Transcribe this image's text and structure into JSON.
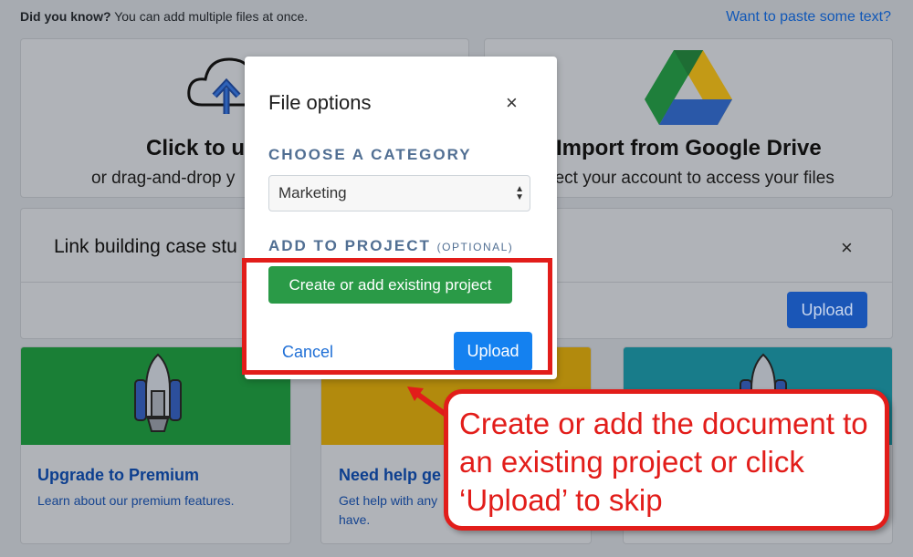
{
  "tip": {
    "label": "Did you know?",
    "text": " You can add multiple files at once."
  },
  "paste_link": "Want to paste some text?",
  "upload_card": {
    "title": "Click to u",
    "subtitle": "or drag-and-drop y"
  },
  "drive_card": {
    "title": "Import from Google Drive",
    "subtitle": "nect your account to access your files"
  },
  "file_row": {
    "name": "Link building case stu",
    "close": "×",
    "upload": "Upload"
  },
  "premium_card": {
    "title": "Upgrade to Premium",
    "text": "Learn about our premium features."
  },
  "help_card": {
    "title": "Need help ge",
    "text_line1": "Get help with any",
    "text_line2": "have."
  },
  "modal": {
    "title": "File options",
    "close": "×",
    "category_label": "CHOOSE A CATEGORY",
    "category_value": "Marketing",
    "project_label": "ADD TO PROJECT",
    "project_optional": "(OPTIONAL)",
    "project_button": "Create or add existing project",
    "cancel": "Cancel",
    "upload": "Upload"
  },
  "annotation": {
    "callout_text": "Create or add the document to an existing project or click ‘Upload’ to skip",
    "color": "#e21d1a"
  },
  "colors": {
    "green": "#2a9a47",
    "blue": "#1481f0",
    "label": "#516f93"
  }
}
